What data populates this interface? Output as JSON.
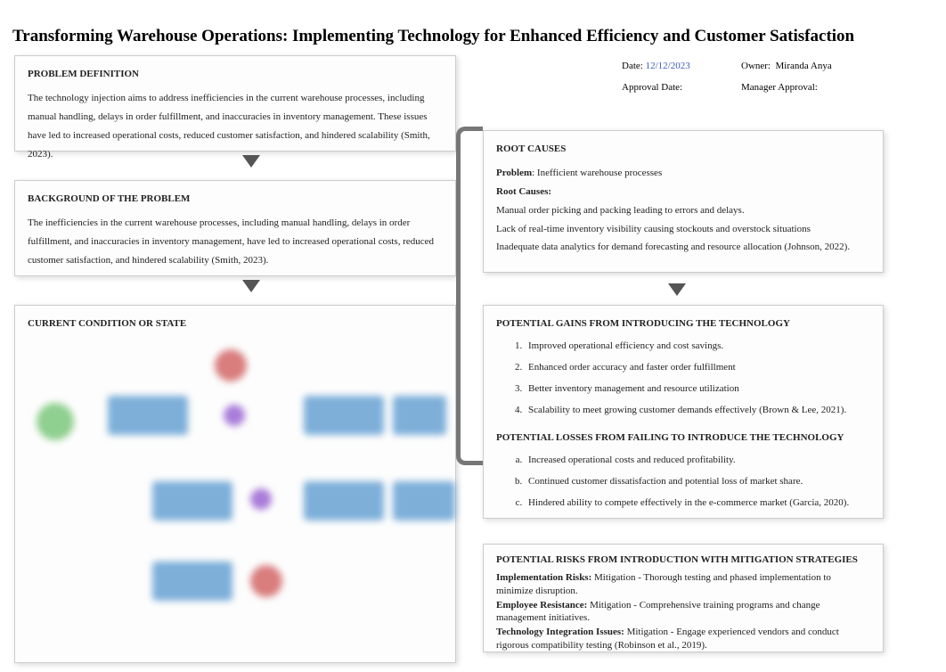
{
  "title": "Transforming Warehouse Operations: Implementing Technology for Enhanced Efficiency and Customer Satisfaction",
  "meta": {
    "date_label": "Date: ",
    "date_value": "12/12/2023",
    "owner_label": "Owner:",
    "owner_value": "Miranda Anya",
    "approval_label": "Approval Date:",
    "manager_label": "Manager Approval:"
  },
  "problem_definition": {
    "heading": "PROBLEM DEFINITION",
    "body": "The technology injection aims to address inefficiencies in the current warehouse processes, including manual handling, delays in order fulfillment, and inaccuracies in inventory management. These issues have led to increased operational costs, reduced customer satisfaction, and hindered scalability (Smith, 2023)."
  },
  "background": {
    "heading": "BACKGROUND OF THE PROBLEM",
    "body": "The inefficiencies in the current warehouse processes, including manual handling, delays in order fulfillment, and inaccuracies in inventory management, have led to increased operational costs, reduced customer satisfaction, and hindered scalability (Smith, 2023)."
  },
  "current_condition": {
    "heading": "CURRENT CONDITION OR STATE"
  },
  "root_causes": {
    "heading": "ROOT CAUSES",
    "problem_label": "Problem",
    "problem_text": ": Inefficient warehouse processes",
    "causes_label": "Root Causes:",
    "causes": [
      "Manual order picking and packing leading to errors and delays.",
      "Lack of real-time inventory visibility causing stockouts and overstock situations",
      "Inadequate data analytics for demand forecasting and resource allocation (Johnson, 2022)."
    ]
  },
  "gains": {
    "heading": "POTENTIAL GAINS FROM INTRODUCING THE TECHNOLOGY",
    "items": [
      "Improved operational efficiency and cost savings.",
      "Enhanced order accuracy and faster order fulfillment",
      "Better inventory management and resource utilization",
      "Scalability to meet growing customer demands effectively (Brown & Lee, 2021)."
    ]
  },
  "losses": {
    "heading": "POTENTIAL LOSSES FROM FAILING TO INTRODUCE THE TECHNOLOGY",
    "items": [
      "Increased operational costs and reduced profitability.",
      "Continued customer dissatisfaction and potential loss of market share.",
      "Hindered ability to compete effectively in the e-commerce market (Garcia, 2020)."
    ]
  },
  "risks": {
    "heading": "POTENTIAL RISKS FROM INTRODUCTION WITH MITIGATION STRATEGIES",
    "items": [
      {
        "label": "Implementation Risks:",
        "text": " Mitigation - Thorough testing and phased implementation to minimize disruption."
      },
      {
        "label": "Employee Resistance:",
        "text": " Mitigation - Comprehensive training programs and change management initiatives."
      },
      {
        "label": "Technology Integration Issues:",
        "text": " Mitigation - Engage experienced vendors and conduct rigorous compatibility testing (Robinson et al., 2019)."
      }
    ]
  }
}
